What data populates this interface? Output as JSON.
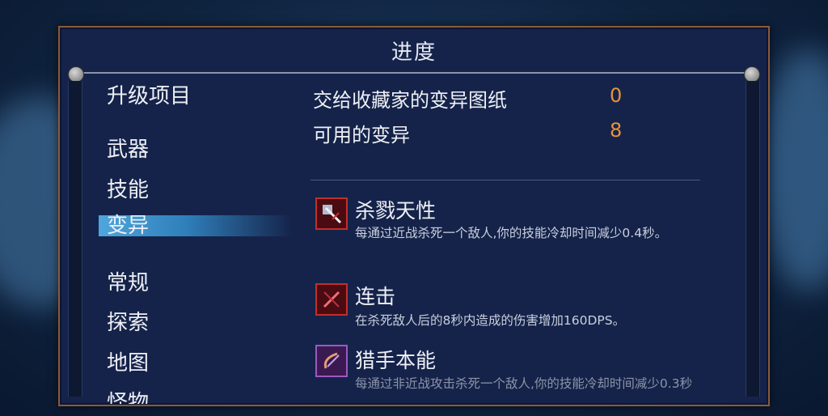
{
  "panel": {
    "title": "进度"
  },
  "nav": {
    "items": [
      {
        "label": "升级项目"
      },
      {
        "label": "武器"
      },
      {
        "label": "技能"
      },
      {
        "label": "变异"
      },
      {
        "label": "常规"
      },
      {
        "label": "探索"
      },
      {
        "label": "地图"
      },
      {
        "label": "怪物"
      }
    ],
    "active_index": 3
  },
  "stats": [
    {
      "label": "交给收藏家的变异图纸",
      "value": "0"
    },
    {
      "label": "可用的变异",
      "value": "8"
    }
  ],
  "mutations": [
    {
      "name": "杀戮天性",
      "icon": "red-sword-slash-icon",
      "description": "每通过近战杀死一个敌人,你的技能冷却时间减少0.4秒。"
    },
    {
      "name": "连击",
      "icon": "red-combo-icon",
      "description": "在杀死敌人后的8秒内造成的伤害增加160DPS。"
    },
    {
      "name": "猎手本能",
      "icon": "purple-bow-icon",
      "description": "每通过非近战攻击杀死一个敌人,你的技能冷却时间减少0.3秒"
    }
  ],
  "colors": {
    "accent": "#e8923a",
    "active_tab": "#3a8fcf",
    "panel_bg": "#15234a"
  }
}
